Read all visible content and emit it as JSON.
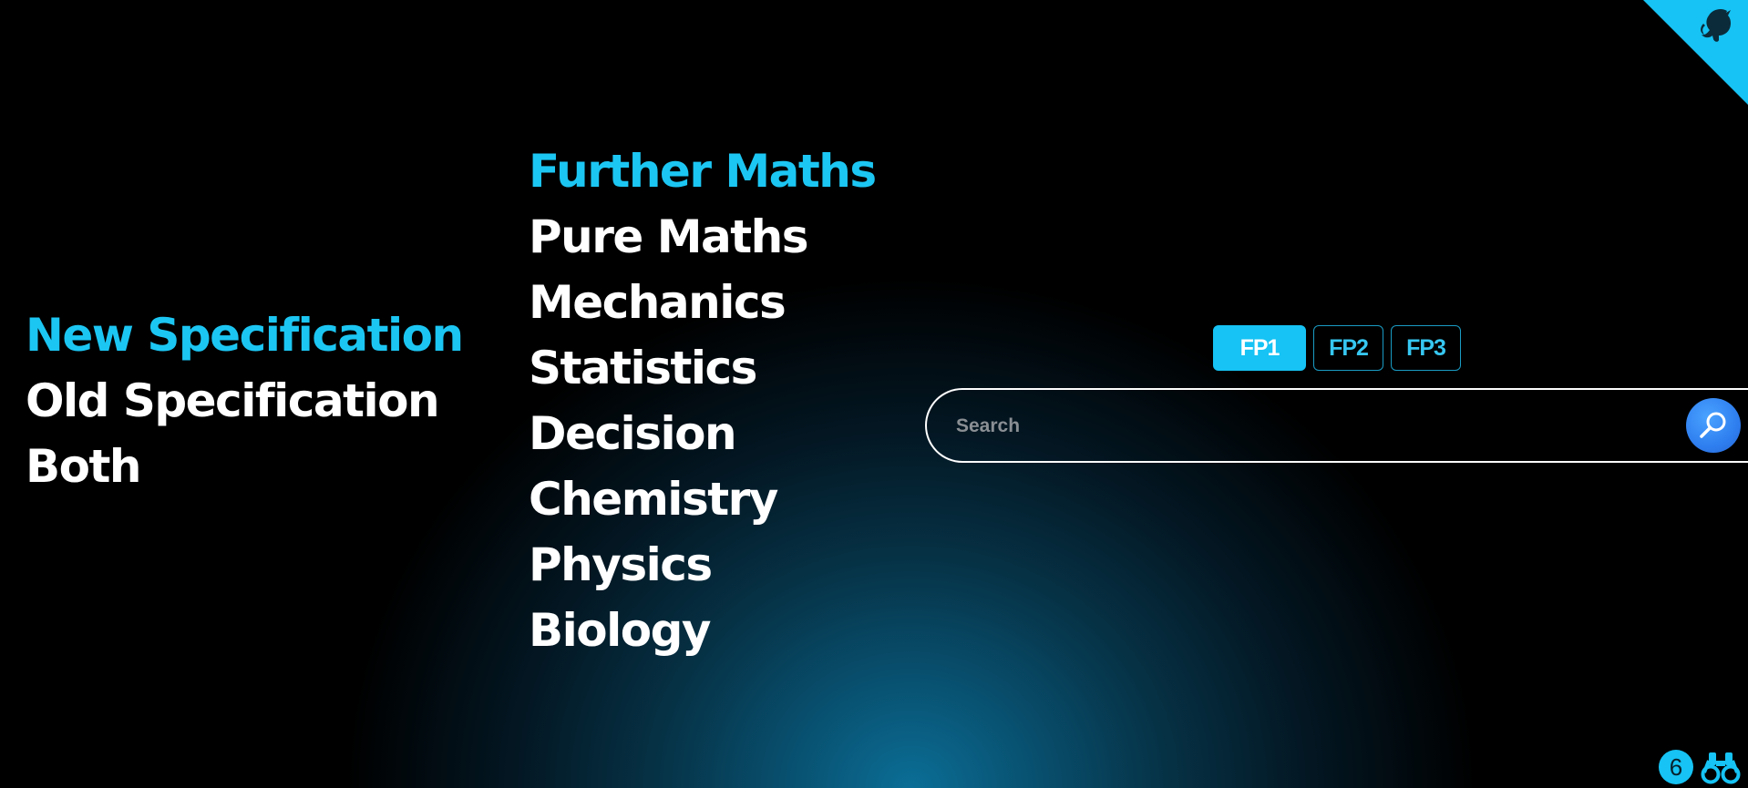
{
  "specification_menu": {
    "items": [
      {
        "label": "New Specification",
        "active": true
      },
      {
        "label": "Old Specification",
        "active": false
      },
      {
        "label": "Both",
        "active": false
      }
    ]
  },
  "subject_menu": {
    "items": [
      {
        "label": "Further Maths",
        "active": true
      },
      {
        "label": "Pure Maths",
        "active": false
      },
      {
        "label": "Mechanics",
        "active": false
      },
      {
        "label": "Statistics",
        "active": false
      },
      {
        "label": "Decision",
        "active": false
      },
      {
        "label": "Chemistry",
        "active": false
      },
      {
        "label": "Physics",
        "active": false
      },
      {
        "label": "Biology",
        "active": false
      }
    ]
  },
  "module_tabs": [
    {
      "label": "FP1",
      "active": true
    },
    {
      "label": "FP2",
      "active": false
    },
    {
      "label": "FP3",
      "active": false
    }
  ],
  "search": {
    "placeholder": "Search",
    "value": "",
    "button_icon": "search-icon"
  },
  "corner": {
    "icon": "github-octocat-icon"
  },
  "footer": {
    "count": "6",
    "count_icon": "count-badge",
    "tool_icon": "binoculars-icon"
  },
  "colors": {
    "accent": "#1cc6f3",
    "text": "#ffffff",
    "background": "#000000",
    "glow": "#0b6e96",
    "search_button": "#2f7ff0"
  }
}
